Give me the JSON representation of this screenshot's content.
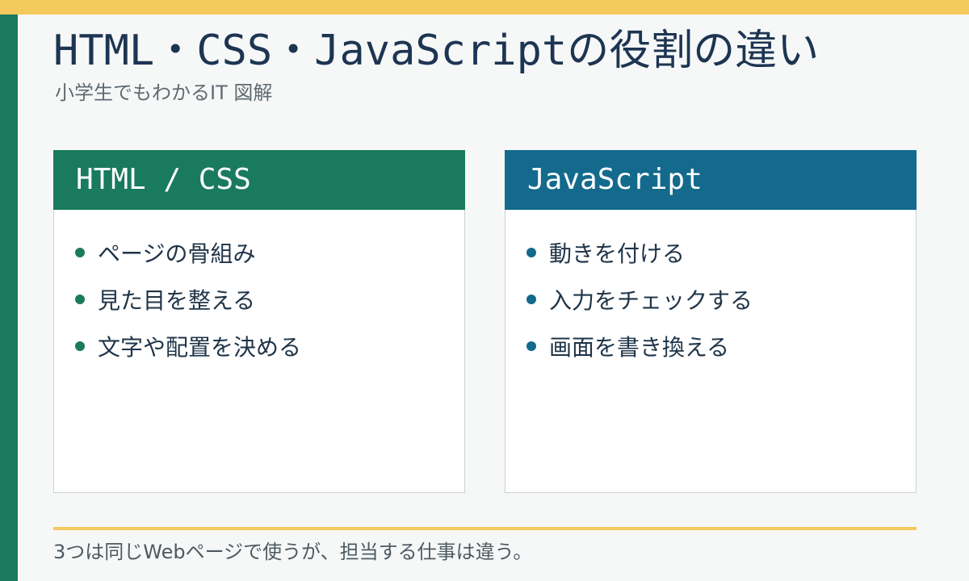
{
  "title": "HTML・CSS・JavaScriptの役割の違い",
  "subtitle": "小学生でもわかるIT 図解",
  "colors": {
    "accent_yellow": "#f4c95d",
    "green": "#1a7a5e",
    "blue": "#136a8c",
    "text_dark": "#1d3552"
  },
  "cards": [
    {
      "header": "HTML / CSS",
      "items": [
        "ページの骨組み",
        "見た目を整える",
        "文字や配置を決める"
      ]
    },
    {
      "header": "JavaScript",
      "items": [
        "動きを付ける",
        "入力をチェックする",
        "画面を書き換える"
      ]
    }
  ],
  "footer": "3つは同じWebページで使うが、担当する仕事は違う。"
}
